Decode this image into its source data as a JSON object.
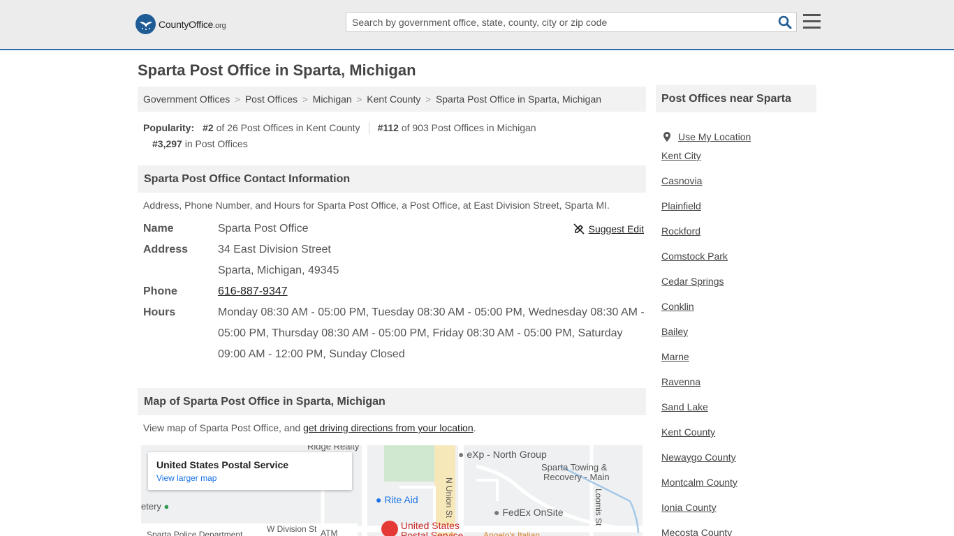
{
  "header": {
    "logo_main": "CountyOffice",
    "logo_tld": ".org",
    "search_placeholder": "Search by government office, state, county, city or zip code"
  },
  "page_title": "Sparta Post Office in Sparta, Michigan",
  "breadcrumb": [
    "Government Offices",
    "Post Offices",
    "Michigan",
    "Kent County",
    "Sparta Post Office in Sparta, Michigan"
  ],
  "popularity": {
    "label": "Popularity:",
    "rank1": "#2",
    "rank1_text": "of 26 Post Offices in Kent County",
    "rank2": "#112",
    "rank2_text": "of 903 Post Offices in Michigan",
    "rank3": "#3,297",
    "rank3_text": "in Post Offices"
  },
  "contact": {
    "heading": "Sparta Post Office Contact Information",
    "description": "Address, Phone Number, and Hours for Sparta Post Office, a Post Office, at East Division Street, Sparta MI.",
    "suggest_edit": "Suggest Edit",
    "name_label": "Name",
    "name": "Sparta Post Office",
    "address_label": "Address",
    "address_line1": "34 East Division Street",
    "address_line2": "Sparta, Michigan, 49345",
    "phone_label": "Phone",
    "phone": "616-887-9347",
    "hours_label": "Hours",
    "hours": "Monday 08:30 AM - 05:00 PM, Tuesday 08:30 AM - 05:00 PM, Wednesday 08:30 AM - 05:00 PM, Thursday 08:30 AM - 05:00 PM, Friday 08:30 AM - 05:00 PM, Saturday 09:00 AM - 12:00 PM, Sunday Closed"
  },
  "map_section": {
    "heading": "Map of Sparta Post Office in Sparta, Michigan",
    "desc_prefix": "View map of Sparta Post Office, and ",
    "desc_link": "get driving directions from your location",
    "desc_suffix": ".",
    "card_title": "United States Postal Service",
    "card_link": "View larger map",
    "labels": {
      "ridge": "Ridge Realty",
      "exp": "eXp - North Group",
      "towing1": "Sparta Towing &",
      "towing2": "Recovery - Main",
      "rite_aid": "Rite Aid",
      "fedex": "FedEx OnSite",
      "cemetery": "etery",
      "w_division": "W Division St",
      "police": "Sparta Police Department",
      "atm": "ATM",
      "usps1": "United States",
      "usps2": "Postal Service",
      "angelos": "Angelo's Italian",
      "n_union": "N Union St",
      "loomis": "Loomis St"
    }
  },
  "sidebar": {
    "heading": "Post Offices near Sparta",
    "use_location": "Use My Location",
    "items": [
      "Kent City",
      "Casnovia",
      "Plainfield",
      "Rockford",
      "Comstock Park",
      "Cedar Springs",
      "Conklin",
      "Bailey",
      "Marne",
      "Ravenna",
      "Sand Lake",
      "Kent County",
      "Newaygo County",
      "Montcalm County",
      "Ionia County",
      "Mecosta County"
    ]
  },
  "colors": {
    "brand_blue": "#1f5b95",
    "header_bg": "#ececec",
    "panel_bg": "#f2f2f2",
    "map_marker": "#e53935"
  }
}
